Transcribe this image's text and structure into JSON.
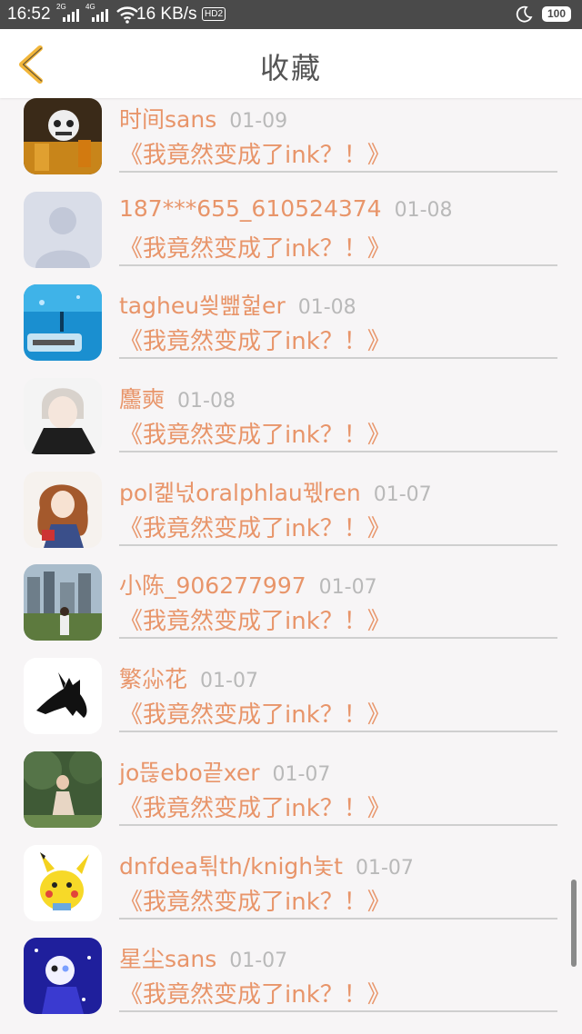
{
  "status_bar": {
    "time": "16:52",
    "signal1_tag": "2G",
    "signal2_tag": "4G",
    "speed": "16 KB/s",
    "hd": "HD2",
    "battery": "100"
  },
  "header": {
    "title": "收藏",
    "back_icon": "chevron-left-icon",
    "accent": "#f2b63a"
  },
  "colors": {
    "name": "#e8956a",
    "date": "#b9b9b9",
    "divider": "#cfcfcf"
  },
  "items": [
    {
      "name": "时间sans",
      "date": "01-09",
      "book": "《我竟然变成了ink？！》",
      "avatar": "skeleton-avatar"
    },
    {
      "name": "187***655_610524374",
      "date": "01-08",
      "book": "《我竟然变成了ink？！》",
      "avatar": "default-user-avatar"
    },
    {
      "name": "tagheu씢뺊헕er",
      "date": "01-08",
      "book": "《我竟然变成了ink？！》",
      "avatar": "ocean-avatar"
    },
    {
      "name": "麢奭",
      "date": "01-08",
      "book": "《我竟然变成了ink？！》",
      "avatar": "anime-boy-avatar"
    },
    {
      "name": "pol켍넋oralphlau꿳ren",
      "date": "01-07",
      "book": "《我竟然变成了ink？！》",
      "avatar": "anime-girl-avatar"
    },
    {
      "name": "小陈_906277997",
      "date": "01-07",
      "book": "《我竟然变成了ink？！》",
      "avatar": "city-photo-avatar"
    },
    {
      "name": "繁尛花",
      "date": "01-07",
      "book": "《我竟然变成了ink？！》",
      "avatar": "cat-silhouette-avatar"
    },
    {
      "name": "jo뜮ebo끝xer",
      "date": "01-07",
      "book": "《我竟然变成了ink？！》",
      "avatar": "forest-woman-avatar"
    },
    {
      "name": "dnfdea퇶th/knigh놏t",
      "date": "01-07",
      "book": "《我竟然变成了ink？！》",
      "avatar": "pikachu-avatar"
    },
    {
      "name": "星尘sans",
      "date": "01-07",
      "book": "《我竟然变成了ink？！》",
      "avatar": "starry-skeleton-avatar"
    }
  ]
}
